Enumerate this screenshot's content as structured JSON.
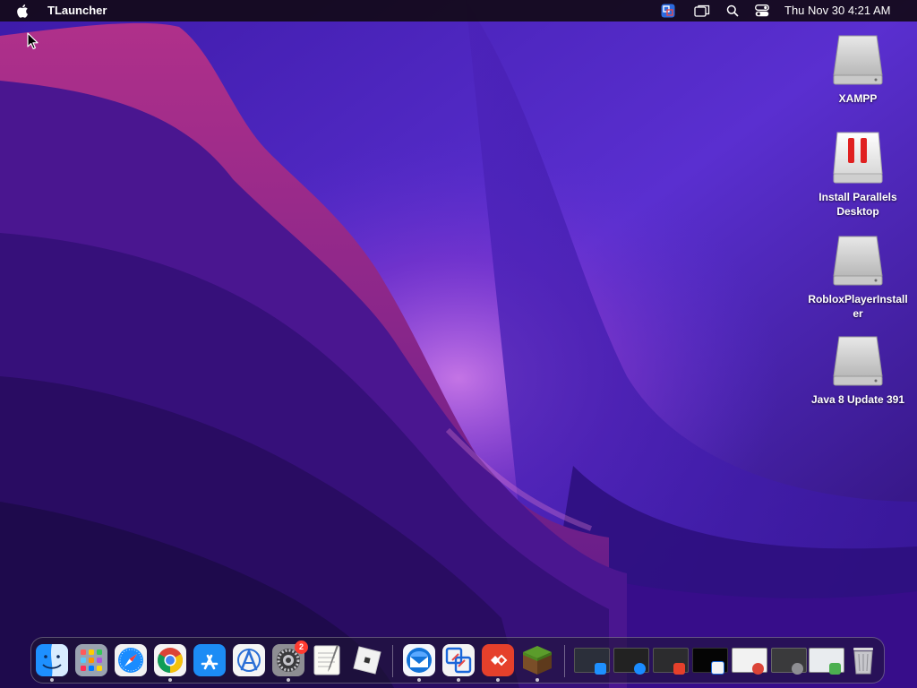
{
  "menubar": {
    "app_name": "TLauncher",
    "clock": "Thu Nov 30  4:21 AM",
    "status_icons": [
      "teamviewer-icon",
      "screen-mirroring-icon",
      "spotlight-search-icon",
      "control-center-icon"
    ]
  },
  "desktop": {
    "icons": [
      {
        "label": "XAMPP",
        "icon": "disk-image-icon"
      },
      {
        "label": "Install Parallels Desktop",
        "icon": "parallels-installer-icon"
      },
      {
        "label": "RobloxPlayerInstaller",
        "icon": "disk-image-icon"
      },
      {
        "label": "Java 8 Update 391",
        "icon": "disk-image-icon"
      }
    ]
  },
  "dock": {
    "apps": [
      {
        "name": "Finder",
        "icon": "finder-icon",
        "running": true
      },
      {
        "name": "Launchpad",
        "icon": "launchpad-icon",
        "running": false
      },
      {
        "name": "Safari",
        "icon": "safari-icon",
        "running": false
      },
      {
        "name": "Google Chrome",
        "icon": "chrome-icon",
        "running": true
      },
      {
        "name": "App Store",
        "icon": "app-store-icon",
        "running": false
      },
      {
        "name": "Xcode Instruments",
        "icon": "instruments-icon",
        "running": false
      },
      {
        "name": "System Settings",
        "icon": "system-settings-icon",
        "running": true,
        "badge": "2"
      },
      {
        "name": "TextEdit",
        "icon": "textedit-icon",
        "running": false
      },
      {
        "name": "Roblox",
        "icon": "roblox-icon",
        "running": false
      }
    ],
    "recent_apps": [
      {
        "name": "Thunderbird",
        "icon": "thunderbird-icon",
        "running": true
      },
      {
        "name": "TeamViewer",
        "icon": "teamviewer-icon",
        "running": true
      },
      {
        "name": "AnyDesk",
        "icon": "anydesk-icon",
        "running": true
      },
      {
        "name": "Minecraft",
        "icon": "minecraft-icon",
        "running": true
      }
    ],
    "minimized_windows": [
      {
        "name": "Finder window",
        "icon": "finder-window-thumbnail"
      },
      {
        "name": "Safari window",
        "icon": "safari-window-thumbnail"
      },
      {
        "name": "AnyDesk window",
        "icon": "anydesk-window-thumbnail"
      },
      {
        "name": "TeamViewer window",
        "icon": "teamviewer-window-thumbnail"
      },
      {
        "name": "Chrome window",
        "icon": "chrome-window-thumbnail"
      },
      {
        "name": "Settings window",
        "icon": "settings-window-thumbnail"
      },
      {
        "name": "Document window",
        "icon": "document-window-thumbnail"
      }
    ],
    "trash": {
      "name": "Trash",
      "icon": "trash-icon"
    }
  }
}
